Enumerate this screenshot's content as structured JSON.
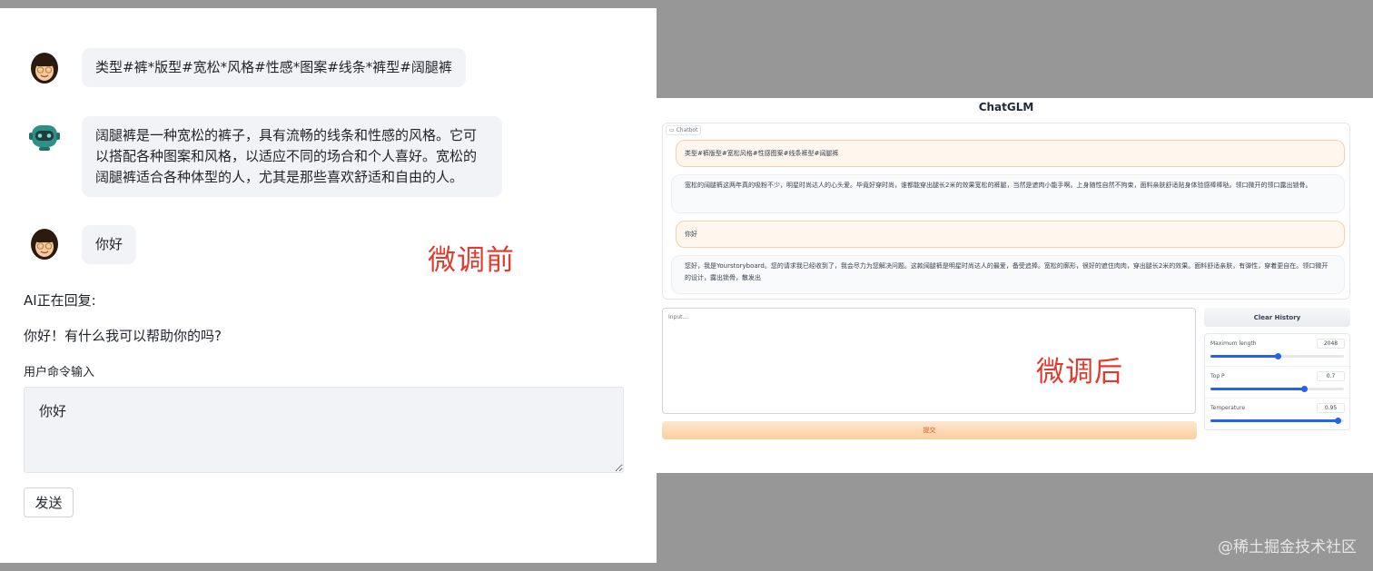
{
  "before": {
    "label": "微调前",
    "messages": [
      {
        "role": "user",
        "text": "类型#裤*版型#宽松*风格#性感*图案#线条*裤型#阔腿裤"
      },
      {
        "role": "bot",
        "text": "阔腿裤是一种宽松的裤子，具有流畅的线条和性感的风格。它可以搭配各种图案和风格，以适应不同的场合和个人喜好。宽松的阔腿裤适合各种体型的人，尤其是那些喜欢舒适和自由的人。"
      },
      {
        "role": "user",
        "text": "你好"
      }
    ],
    "ai_status": "AI正在回复:",
    "ai_reply": "你好！有什么我可以帮助你的吗?",
    "input_label": "用户命令输入",
    "input_value": "你好",
    "send_label": "发送"
  },
  "after": {
    "label": "微调后",
    "title": "ChatGLM",
    "chatbot_label": "Chatbot",
    "messages": [
      {
        "role": "user",
        "text": "类型#裤版型#宽松风格#性感图案#线条裤型#阔腿裤"
      },
      {
        "role": "bot",
        "text": "宽松的阔腿裤这两年真的吸粉不少，明星时尚达人的心头爱。毕竟好穿时尚，谁都能穿出腿长2米的效果宽松的裤腿，当然是遮肉小能手啊。上身随性自然不拘束，面料亲肤舒适贴身体验感棒棒哒。领口微开的领口露出锁骨。"
      },
      {
        "role": "user",
        "text": "你好"
      },
      {
        "role": "bot",
        "text": "您好，我是Yourstoryboard。您的请求我已经收到了，我会尽力为您解决问题。这款阔腿裤是明星时尚达人的最爱，备受追捧。宽松的廓形，很好的遮住肉肉，穿出腿长2米的效果。面料舒适亲肤，有弹性，穿着更自在。领口微开的设计，露出锁骨，散发出"
      }
    ],
    "input_placeholder": "Input...",
    "submit_label": "提交",
    "clear_label": "Clear History",
    "sliders": [
      {
        "name": "Maximum length",
        "value": "2048",
        "fraction": 0.5
      },
      {
        "name": "Top P",
        "value": "0.7",
        "fraction": 0.7
      },
      {
        "name": "Temperature",
        "value": "0.95",
        "fraction": 0.95
      }
    ]
  },
  "watermark": "@稀土掘金技术社区"
}
